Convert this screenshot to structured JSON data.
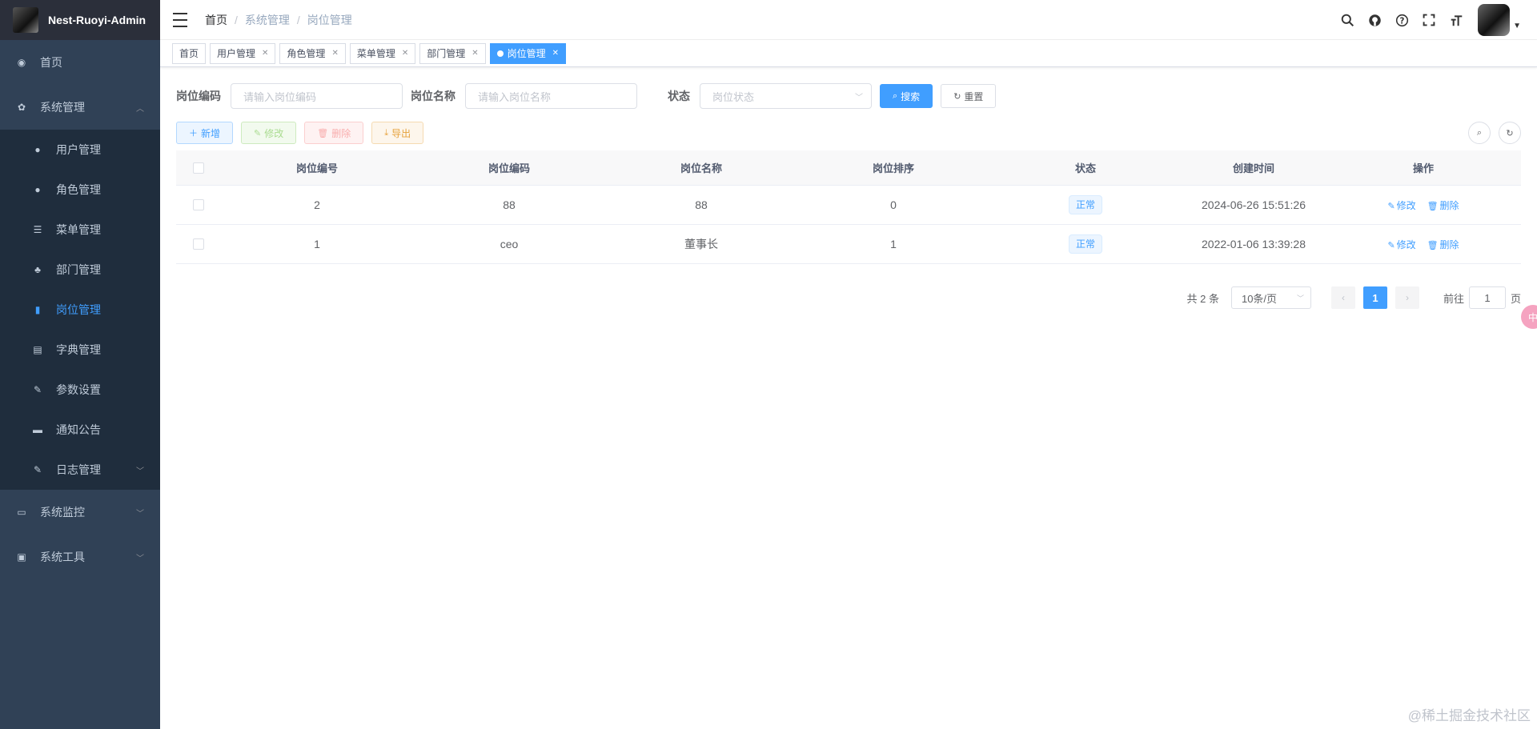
{
  "app": {
    "title": "Nest-Ruoyi-Admin"
  },
  "sidebar": {
    "top": [
      {
        "label": "首页",
        "icon": "dashboard-icon"
      },
      {
        "label": "系统管理",
        "icon": "gear-icon"
      }
    ],
    "system_children": [
      {
        "label": "用户管理",
        "icon": "user-icon"
      },
      {
        "label": "角色管理",
        "icon": "role-icon"
      },
      {
        "label": "菜单管理",
        "icon": "list-icon"
      },
      {
        "label": "部门管理",
        "icon": "tree-icon"
      },
      {
        "label": "岗位管理",
        "icon": "post-icon"
      },
      {
        "label": "字典管理",
        "icon": "dict-icon"
      },
      {
        "label": "参数设置",
        "icon": "edit-icon"
      },
      {
        "label": "通知公告",
        "icon": "message-icon"
      },
      {
        "label": "日志管理",
        "icon": "log-icon"
      }
    ],
    "bottom": [
      {
        "label": "系统监控",
        "icon": "monitor-icon"
      },
      {
        "label": "系统工具",
        "icon": "tool-icon"
      }
    ]
  },
  "breadcrumb": [
    "首页",
    "系统管理",
    "岗位管理"
  ],
  "tags": [
    {
      "label": "首页"
    },
    {
      "label": "用户管理"
    },
    {
      "label": "角色管理"
    },
    {
      "label": "菜单管理"
    },
    {
      "label": "部门管理"
    },
    {
      "label": "岗位管理"
    }
  ],
  "search": {
    "post_code_label": "岗位编码",
    "post_code_placeholder": "请输入岗位编码",
    "post_name_label": "岗位名称",
    "post_name_placeholder": "请输入岗位名称",
    "status_label": "状态",
    "status_placeholder": "岗位状态",
    "search_btn": "搜索",
    "reset_btn": "重置"
  },
  "toolbar": {
    "add": "新增",
    "edit": "修改",
    "delete": "删除",
    "export": "导出"
  },
  "table": {
    "columns": [
      "岗位编号",
      "岗位编码",
      "岗位名称",
      "岗位排序",
      "状态",
      "创建时间",
      "操作"
    ],
    "rows": [
      {
        "id": "2",
        "code": "88",
        "name": "88",
        "sort": "0",
        "status": "正常",
        "created": "2024-06-26 15:51:26",
        "edit": "修改",
        "del": "删除"
      },
      {
        "id": "1",
        "code": "ceo",
        "name": "董事长",
        "sort": "1",
        "status": "正常",
        "created": "2022-01-06 13:39:28",
        "edit": "修改",
        "del": "删除"
      }
    ]
  },
  "pagination": {
    "total": "共 2 条",
    "page_size": "10条/页",
    "current": "1",
    "goto_prefix": "前往",
    "goto_value": "1",
    "goto_suffix": "页"
  },
  "float_badge": "中",
  "watermark": "@稀土掘金技术社区",
  "colors": {
    "sidebar_bg": "#304156",
    "primary": "#409eff"
  }
}
